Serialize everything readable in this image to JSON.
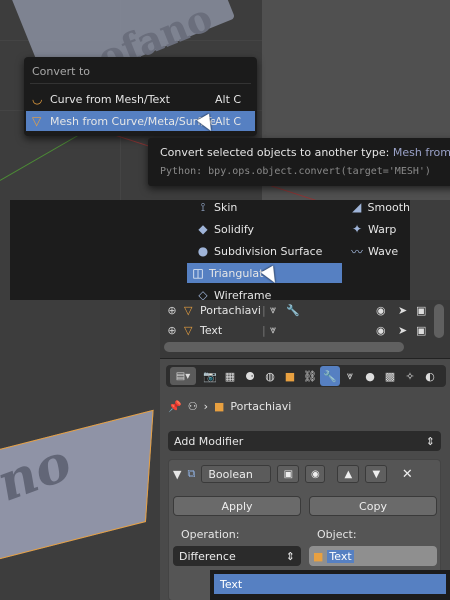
{
  "convert_menu": {
    "title": "Convert to",
    "items": [
      {
        "label": "Curve from Mesh/Text",
        "shortcut": "Alt C",
        "icon": "curve-icon"
      },
      {
        "label": "Mesh from Curve/Meta/Surf/Text",
        "shortcut": "Alt C",
        "icon": "mesh-icon"
      }
    ]
  },
  "tooltip": {
    "description": "Convert selected objects to another type:",
    "type_value": "Mesh from Curv",
    "python": "Python: bpy.ops.object.convert(target='MESH')"
  },
  "modifier_menu": {
    "items": [
      {
        "label": "Skin",
        "icon": "skin-icon"
      },
      {
        "label": "Solidify",
        "icon": "solidify-icon"
      },
      {
        "label": "Subdivision Surface",
        "icon": "subdivision-icon"
      },
      {
        "label": "Triangulate",
        "icon": "triangulate-icon"
      },
      {
        "label": "Wireframe",
        "icon": "wireframe-icon"
      },
      {
        "label": "Smooth",
        "icon": "smooth-icon"
      },
      {
        "label": "Warp",
        "icon": "warp-icon"
      },
      {
        "label": "Wave",
        "icon": "wave-icon"
      }
    ],
    "highlighted_display": "Triangulat"
  },
  "viewport_top": {
    "object_text": "ofano"
  },
  "viewport_bottom": {
    "object_text": "ou"
  },
  "outliner": {
    "rows": [
      {
        "name": "Portachiavi"
      },
      {
        "name": "Text"
      }
    ]
  },
  "properties": {
    "context_object": "Portachiavi",
    "add_modifier_label": "Add Modifier",
    "modifier": {
      "name": "Boolean",
      "apply_label": "Apply",
      "copy_label": "Copy",
      "operation_label": "Operation:",
      "operation_value": "Difference",
      "object_label": "Object:",
      "object_value": "Text"
    },
    "dropdown_item": "Text"
  },
  "colors": {
    "highlight": "#5680c2",
    "object_orange": "#e8a040",
    "menu_bg": "#1b1b1b",
    "panel_bg": "#4a4a4a"
  }
}
